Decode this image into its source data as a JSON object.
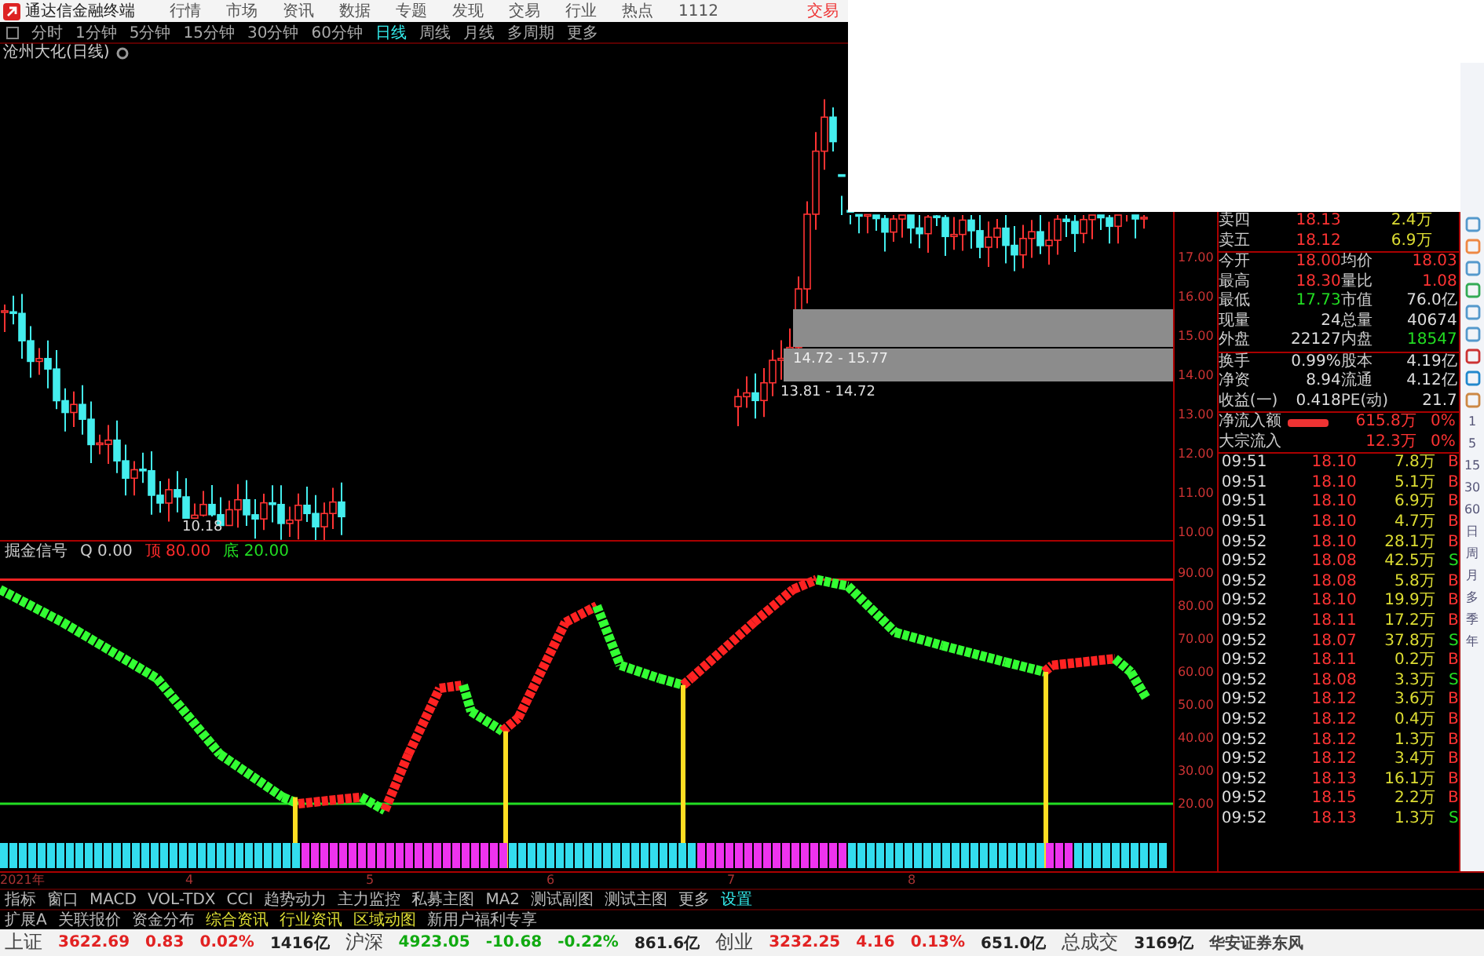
{
  "menu_bar": {
    "app_title": "通达信金融终端",
    "items": [
      "行情",
      "市场",
      "资讯",
      "数据",
      "专题",
      "发现",
      "交易",
      "行业",
      "热点",
      "1112"
    ],
    "trade_link": "交易"
  },
  "period_tabs": [
    {
      "label": "分时",
      "selected": false
    },
    {
      "label": "1分钟",
      "selected": false
    },
    {
      "label": "5分钟",
      "selected": false
    },
    {
      "label": "15分钟",
      "selected": false
    },
    {
      "label": "30分钟",
      "selected": false
    },
    {
      "label": "60分钟",
      "selected": false
    },
    {
      "label": "日线",
      "selected": true
    },
    {
      "label": "周线",
      "selected": false
    },
    {
      "label": "月线",
      "selected": false
    },
    {
      "label": "多周期",
      "selected": false
    },
    {
      "label": "更多",
      "selected": false
    }
  ],
  "chart_title": "沧州大化(日线)",
  "price_chart": {
    "axis_labels": [
      "17.00",
      "16.00",
      "15.00",
      "14.00",
      "13.00",
      "12.00",
      "11.00",
      "10.00"
    ],
    "range_labels": [
      "14.72 - 15.77",
      "13.81 - 14.72"
    ],
    "low_label": "10.18"
  },
  "indicator": {
    "name": "掘金信号",
    "param": "Q 0.00",
    "legends": [
      {
        "label": "顶 80.00",
        "color": "#ff2a2a"
      },
      {
        "label": "底 20.00",
        "color": "#22dd22"
      }
    ],
    "axis_labels": [
      "90.00",
      "80.00",
      "70.00",
      "60.00",
      "50.00",
      "40.00",
      "30.00",
      "20.00"
    ]
  },
  "order_book": [
    {
      "label": "卖四",
      "price": "18.13",
      "volume": "2.4万"
    },
    {
      "label": "卖五",
      "price": "18.12",
      "volume": "6.9万"
    }
  ],
  "quote_stats": [
    {
      "label": "今开",
      "value": "18.00",
      "label_2": "均价",
      "value_2": "18.03"
    },
    {
      "label": "最高",
      "value": "18.30",
      "label_2": "量比",
      "value_2": "1.08"
    },
    {
      "label": "最低",
      "value": "17.73",
      "label_2": "市值",
      "value_2": "76.0亿"
    },
    {
      "label": "现量",
      "value": "24",
      "label_2": "总量",
      "value_2": "40674"
    },
    {
      "label": "外盘",
      "value": "22127",
      "label_2": "内盘",
      "value_2": "18547"
    },
    {
      "label": "换手",
      "value": "0.99%",
      "label_2": "股本",
      "value_2": "4.19亿"
    },
    {
      "label": "净资",
      "value": "8.94",
      "label_2": "流通",
      "value_2": "4.12亿"
    },
    {
      "label": "收益(一)",
      "value": "0.418",
      "label_2": "PE(动)",
      "value_2": "21.7"
    }
  ],
  "flows": [
    {
      "label": "净流入额",
      "value": "615.8万",
      "share": "0%",
      "bar": true
    },
    {
      "label": "大宗流入",
      "value": "12.3万",
      "share": "0%"
    }
  ],
  "trades": [
    {
      "time": "09:51",
      "price": "18.10",
      "volume": "7.8万",
      "side": "B",
      "kind": "buy"
    },
    {
      "time": "09:51",
      "price": "18.10",
      "volume": "5.1万",
      "side": "B",
      "kind": "buy"
    },
    {
      "time": "09:51",
      "price": "18.10",
      "volume": "6.9万",
      "side": "B",
      "kind": "buy"
    },
    {
      "time": "09:51",
      "price": "18.10",
      "volume": "4.7万",
      "side": "B",
      "kind": "buy"
    },
    {
      "time": "09:52",
      "price": "18.10",
      "volume": "28.1万",
      "side": "B",
      "kind": "buy"
    },
    {
      "time": "09:52",
      "price": "18.08",
      "volume": "42.5万",
      "side": "S",
      "kind": "sell"
    },
    {
      "time": "09:52",
      "price": "18.08",
      "volume": "5.8万",
      "side": "B",
      "kind": "buy"
    },
    {
      "time": "09:52",
      "price": "18.10",
      "volume": "19.9万",
      "side": "B",
      "kind": "buy"
    },
    {
      "time": "09:52",
      "price": "18.11",
      "volume": "17.2万",
      "side": "B",
      "kind": "buy"
    },
    {
      "time": "09:52",
      "price": "18.07",
      "volume": "37.8万",
      "side": "S",
      "kind": "sell"
    },
    {
      "time": "09:52",
      "price": "18.11",
      "volume": "0.2万",
      "side": "B",
      "kind": "buy"
    },
    {
      "time": "09:52",
      "price": "18.08",
      "volume": "3.3万",
      "side": "S",
      "kind": "sell"
    },
    {
      "time": "09:52",
      "price": "18.12",
      "volume": "3.6万",
      "side": "B",
      "kind": "buy"
    },
    {
      "time": "09:52",
      "price": "18.12",
      "volume": "0.4万",
      "side": "B",
      "kind": "buy"
    },
    {
      "time": "09:52",
      "price": "18.12",
      "volume": "1.3万",
      "side": "B",
      "kind": "buy"
    },
    {
      "time": "09:52",
      "price": "18.12",
      "volume": "3.4万",
      "side": "B",
      "kind": "buy"
    },
    {
      "time": "09:52",
      "price": "18.13",
      "volume": "16.1万",
      "side": "B",
      "kind": "buy"
    },
    {
      "time": "09:52",
      "price": "18.15",
      "volume": "2.2万",
      "side": "B",
      "kind": "buy"
    },
    {
      "time": "09:52",
      "price": "18.13",
      "volume": "1.3万",
      "side": "S",
      "kind": "sell"
    }
  ],
  "side_toolbar": [
    "1",
    "5",
    "15",
    "30",
    "60",
    "日",
    "周",
    "月",
    "多",
    "季",
    "年"
  ],
  "date_axis": [
    "2021年",
    "4",
    "5",
    "6",
    "7",
    "8"
  ],
  "indicator_tabs": [
    {
      "label": "指标",
      "kind": "tab"
    },
    {
      "label": "窗口",
      "kind": "tab"
    },
    {
      "label": "MACD",
      "kind": "tab"
    },
    {
      "label": "VOL-TDX",
      "kind": "tab"
    },
    {
      "label": "CCI",
      "kind": "tab"
    },
    {
      "label": "趋势动力",
      "kind": "tab"
    },
    {
      "label": "主力监控",
      "kind": "tab"
    },
    {
      "label": "私募主图",
      "kind": "tab"
    },
    {
      "label": "MA2",
      "kind": "tab"
    },
    {
      "label": "测试副图",
      "kind": "tab"
    },
    {
      "label": "测试主图",
      "kind": "tab"
    },
    {
      "label": "更多",
      "kind": "tab"
    },
    {
      "label": "设置",
      "kind": "link"
    }
  ],
  "extension_tabs": [
    {
      "label": "扩展A",
      "kind": "tab"
    },
    {
      "label": "关联报价",
      "kind": "tab"
    },
    {
      "label": "资金分布",
      "kind": "tab"
    },
    {
      "label": "综合资讯",
      "kind": "feature"
    },
    {
      "label": "行业资讯",
      "kind": "feature"
    },
    {
      "label": "区域动图",
      "kind": "feature"
    },
    {
      "label": "新用户福利专享",
      "kind": "tab"
    }
  ],
  "status_bar": {
    "indices": [
      {
        "name": "上证",
        "value": "3622.69",
        "change": "0.83",
        "pct": "0.02%",
        "amount": "1416亿",
        "color": "#e22222"
      },
      {
        "name": "沪深",
        "value": "4923.05",
        "change": "-10.68",
        "pct": "-0.22%",
        "amount": "861.6亿",
        "color": "#11aa11"
      },
      {
        "name": "创业",
        "value": "3232.25",
        "change": "4.16",
        "pct": "0.13%",
        "amount": "651.0亿",
        "color": "#e22222"
      }
    ],
    "total_label": "总成交",
    "total_value": "3169亿",
    "broker": "华安证券东风"
  }
}
